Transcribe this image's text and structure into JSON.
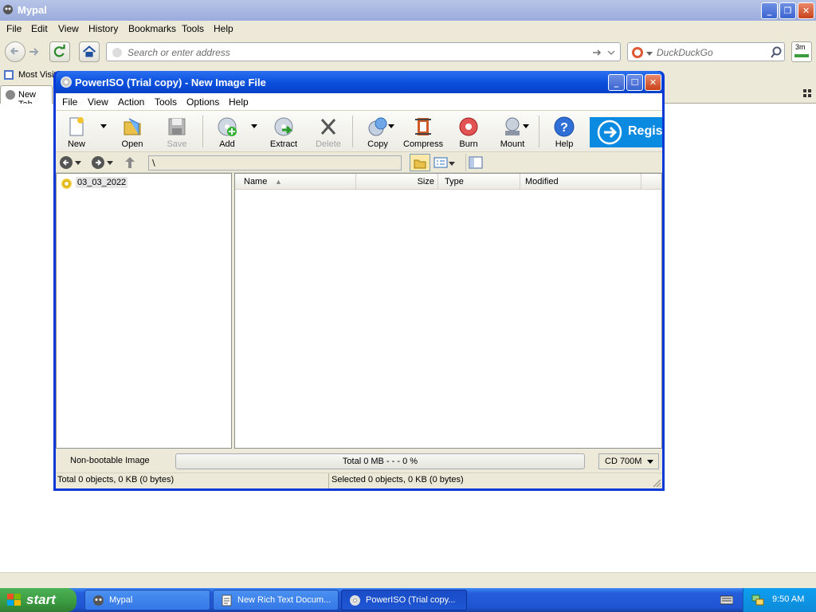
{
  "browser": {
    "title": "Mypal",
    "menu": [
      "File",
      "Edit",
      "View",
      "History",
      "Bookmarks",
      "Tools",
      "Help"
    ],
    "address_placeholder": "Search or enter address",
    "search_placeholder": "DuckDuckGo",
    "addon_badge": "3m",
    "bookmarks_item": "Most Visit",
    "tab_label": "New Tab"
  },
  "poweriso": {
    "title": "PowerISO (Trial copy) - New Image File",
    "menu": [
      "File",
      "View",
      "Action",
      "Tools",
      "Options",
      "Help"
    ],
    "toolbar": {
      "new": "New",
      "open": "Open",
      "save": "Save",
      "add": "Add",
      "extract": "Extract",
      "delete": "Delete",
      "copy": "Copy",
      "compress": "Compress",
      "burn": "Burn",
      "mount": "Mount",
      "help": "Help",
      "register": "Regis"
    },
    "path": "\\",
    "tree_root": "03_03_2022",
    "columns": [
      "Name",
      "Size",
      "Type",
      "Modified"
    ],
    "status": {
      "boot": "Non-bootable Image",
      "total_usage": "Total  0 MB   - - -  0 %",
      "usage_fraction": 0,
      "capacity": "CD 700M",
      "total_objects": "Total 0 objects, 0 KB (0 bytes)",
      "selected_objects": "Selected 0 objects, 0 KB (0 bytes)"
    }
  },
  "taskbar": {
    "start": "start",
    "tasks": [
      "Mypal",
      "New Rich Text Docum...",
      "PowerISO (Trial copy..."
    ],
    "clock": "9:50 AM"
  },
  "colors": {
    "xp_blue": "#0839d6",
    "register_blue": "#0a8ae0",
    "start_green": "#3a9a3f"
  }
}
